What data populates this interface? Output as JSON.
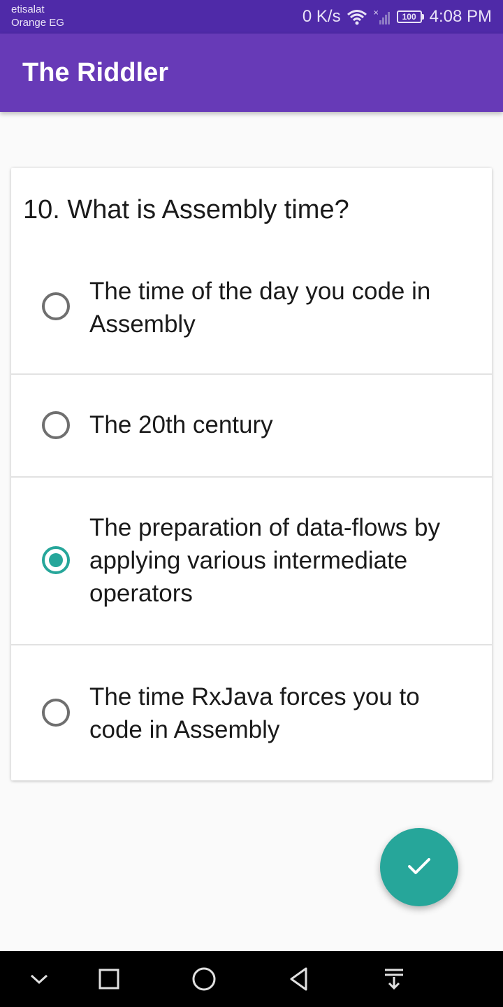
{
  "status_bar": {
    "carrier_line1": "etisalat",
    "carrier_line2": "Orange EG",
    "net_speed": "0 K/s",
    "battery": "100",
    "time": "4:08 PM"
  },
  "app_bar": {
    "title": "The Riddler"
  },
  "question": {
    "text": "10. What is Assembly time?",
    "selected_index": 2,
    "options": [
      {
        "label": "The time of the day you code in Assembly",
        "checked": false
      },
      {
        "label": "The 20th century",
        "checked": false
      },
      {
        "label": "The preparation of data-flows by applying various intermediate operators",
        "checked": true
      },
      {
        "label": "The time RxJava forces you to code in Assembly",
        "checked": false
      }
    ]
  },
  "fab": {
    "icon": "check-icon"
  },
  "nav_bar": {
    "icons": [
      "chevron-down-icon",
      "square-icon",
      "circle-icon",
      "triangle-back-icon",
      "notification-pull-icon"
    ]
  },
  "colors": {
    "status_bar": "#4f2aa8",
    "app_bar": "#673ab7",
    "accent": "#26a69a",
    "background": "#fafafa"
  }
}
